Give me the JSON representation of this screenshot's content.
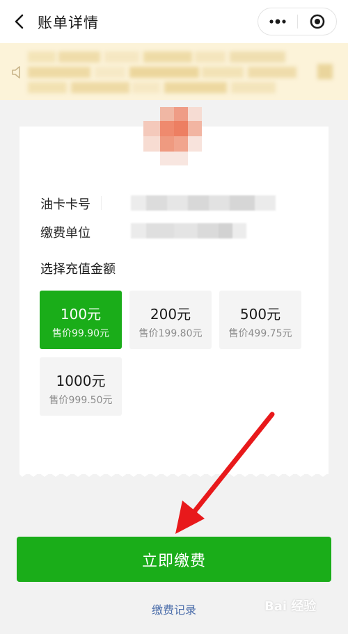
{
  "header": {
    "title": "账单详情"
  },
  "card": {
    "rows": [
      {
        "label": "油卡卡号"
      },
      {
        "label": "缴费单位"
      }
    ],
    "section_title": "选择充值金额",
    "amounts": [
      {
        "amount": "100元",
        "price": "售价99.90元",
        "selected": true
      },
      {
        "amount": "200元",
        "price": "售价199.80元",
        "selected": false
      },
      {
        "amount": "500元",
        "price": "售价499.75元",
        "selected": false
      },
      {
        "amount": "1000元",
        "price": "售价999.50元",
        "selected": false
      }
    ]
  },
  "actions": {
    "pay_label": "立即缴费",
    "records_label": "缴费记录"
  },
  "watermark": {
    "text": "Bai 经验"
  },
  "colors": {
    "accent_green": "#1aad19",
    "notice_background": "#fcf3d9",
    "link_blue": "#4c6eab",
    "annotation_arrow": "#e8191b"
  },
  "icons": [
    "back-arrow-icon",
    "more-dots-icon",
    "close-target-icon",
    "speaker-icon",
    "red-arrow-annotation"
  ]
}
